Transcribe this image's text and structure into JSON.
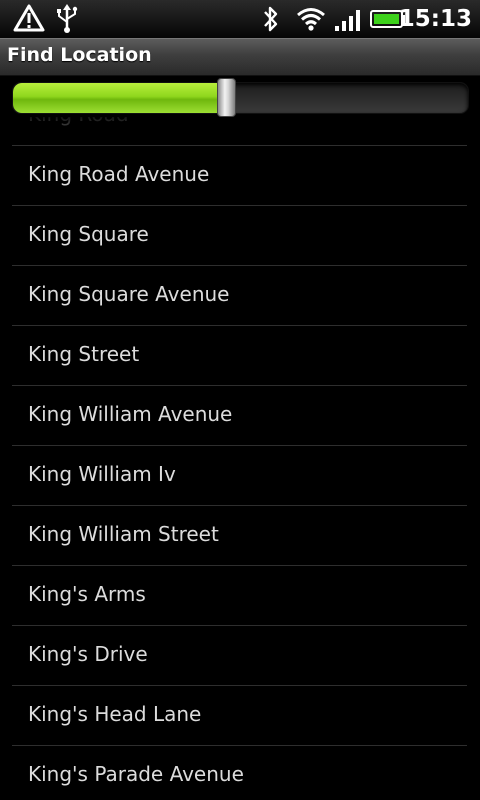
{
  "status_bar": {
    "time": "15:13",
    "icons": [
      "warning-icon",
      "usb-icon",
      "bluetooth-icon",
      "wifi-icon",
      "signal-icon",
      "battery-icon"
    ]
  },
  "app": {
    "title": "Find Location"
  },
  "progress": {
    "value_fraction": 0.47,
    "fill_color": "#8fd61d"
  },
  "list": {
    "items": [
      {
        "label": "King Road"
      },
      {
        "label": "King Road Avenue"
      },
      {
        "label": "King Square"
      },
      {
        "label": "King Square Avenue"
      },
      {
        "label": "King Street"
      },
      {
        "label": "King William Avenue"
      },
      {
        "label": "King William Iv"
      },
      {
        "label": "King William Street"
      },
      {
        "label": "King's Arms"
      },
      {
        "label": "King's Drive"
      },
      {
        "label": "King's Head Lane"
      },
      {
        "label": "King's Parade Avenue"
      }
    ]
  }
}
